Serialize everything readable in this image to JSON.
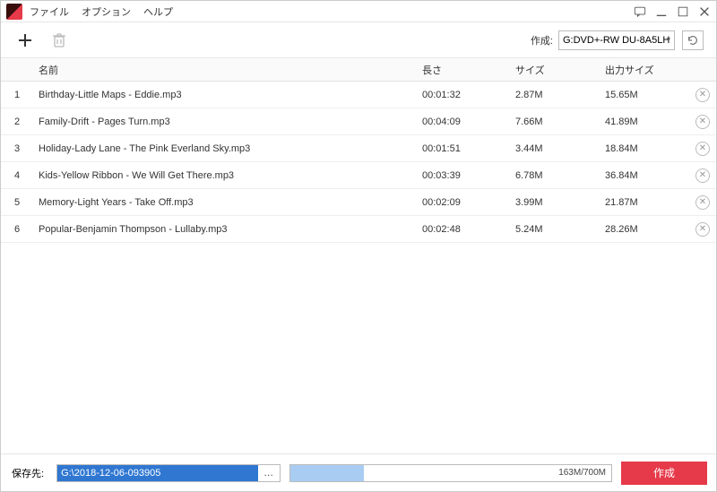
{
  "menu": {
    "file": "ファイル",
    "options": "オプション",
    "help": "ヘルプ"
  },
  "toolbar": {
    "create_label": "作成:",
    "drive": "G:DVD+-RW DU-8A5LH"
  },
  "columns": {
    "name": "名前",
    "length": "長さ",
    "size": "サイズ",
    "outsize": "出力サイズ"
  },
  "rows": [
    {
      "idx": "1",
      "name": "Birthday-Little Maps - Eddie.mp3",
      "len": "00:01:32",
      "size": "2.87M",
      "out": "15.65M"
    },
    {
      "idx": "2",
      "name": "Family-Drift - Pages Turn.mp3",
      "len": "00:04:09",
      "size": "7.66M",
      "out": "41.89M"
    },
    {
      "idx": "3",
      "name": "Holiday-Lady Lane - The Pink Everland Sky.mp3",
      "len": "00:01:51",
      "size": "3.44M",
      "out": "18.84M"
    },
    {
      "idx": "4",
      "name": "Kids-Yellow Ribbon - We Will Get There.mp3",
      "len": "00:03:39",
      "size": "6.78M",
      "out": "36.84M"
    },
    {
      "idx": "5",
      "name": "Memory-Light Years - Take Off.mp3",
      "len": "00:02:09",
      "size": "3.99M",
      "out": "21.87M"
    },
    {
      "idx": "6",
      "name": "Popular-Benjamin Thompson - Lullaby.mp3",
      "len": "00:02:48",
      "size": "5.24M",
      "out": "28.26M"
    }
  ],
  "footer": {
    "save_label": "保存先:",
    "path": "G:\\2018-12-06-093905",
    "browse": "…",
    "progress_text": "163M/700M",
    "progress_pct": 23,
    "create_btn": "作成"
  }
}
